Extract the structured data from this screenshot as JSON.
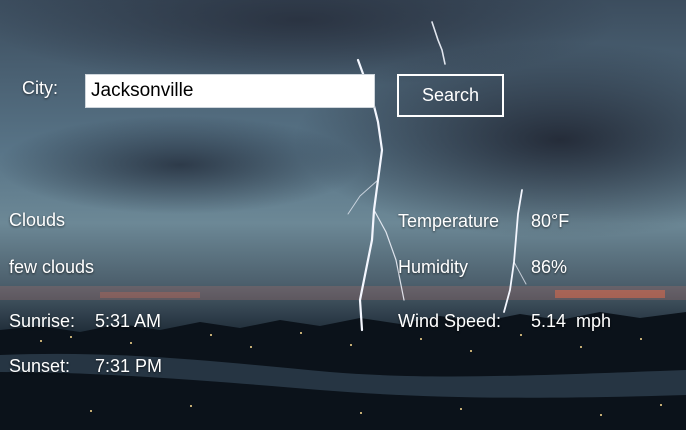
{
  "search": {
    "city_label": "City:",
    "city_value": "Jacksonville",
    "button_label": "Search"
  },
  "weather": {
    "condition": "Clouds",
    "description": "few clouds",
    "sunrise_label": "Sunrise:",
    "sunrise_value": "5:31 AM",
    "sunset_label": "Sunset:",
    "sunset_value": "7:31 PM",
    "temperature_label": "Temperature",
    "temperature_value": "80°F",
    "humidity_label": "Humidity",
    "humidity_value": "86%",
    "wind_label": "Wind Speed:",
    "wind_value": "5.14  mph"
  },
  "background": {
    "scene": "storm-lightning-city-image"
  }
}
